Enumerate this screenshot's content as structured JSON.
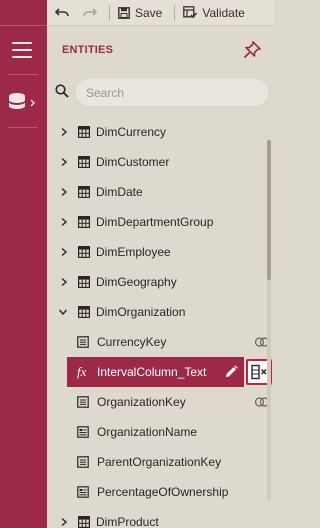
{
  "toolbar": {
    "undo_icon": "undo-icon",
    "redo_icon": "redo-icon",
    "save_label": "Save",
    "validate_label": "Validate"
  },
  "panel": {
    "title": "ENTITIES",
    "search_placeholder": "Search"
  },
  "colors": {
    "accent": "#9c2a47",
    "panel_bg": "#ddd9cf",
    "highlight_border": "#c9213c"
  },
  "tree": {
    "tables": [
      {
        "label": "DimCurrency"
      },
      {
        "label": "DimCustomer"
      },
      {
        "label": "DimDate"
      },
      {
        "label": "DimDepartmentGroup"
      },
      {
        "label": "DimEmployee"
      },
      {
        "label": "DimGeography"
      },
      {
        "label": "DimOrganization"
      },
      {
        "label": "DimProduct"
      }
    ],
    "columns": [
      {
        "label": "CurrencyKey"
      },
      {
        "label": "IntervalColumn_Text"
      },
      {
        "label": "OrganizationKey"
      },
      {
        "label": "OrganizationName"
      },
      {
        "label": "ParentOrganizationKey"
      },
      {
        "label": "PercentageOfOwnership"
      }
    ],
    "formula_symbol": "fx"
  }
}
